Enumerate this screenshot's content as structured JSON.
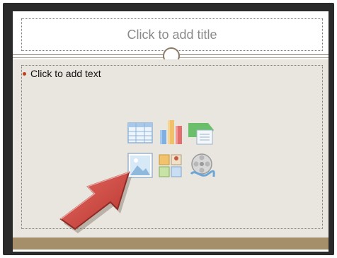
{
  "slide": {
    "title_placeholder": "Click to add title",
    "body_placeholder": "Click to add text"
  },
  "content_icons": [
    {
      "name": "insert-table-icon"
    },
    {
      "name": "insert-chart-icon"
    },
    {
      "name": "insert-smartart-icon"
    },
    {
      "name": "insert-picture-icon"
    },
    {
      "name": "insert-clipart-icon"
    },
    {
      "name": "insert-media-icon"
    }
  ],
  "colors": {
    "frame": "#2a2a2a",
    "content_bg": "#e9e5df",
    "footer_band": "#a58e6a",
    "bullet": "#c0401e",
    "arrow": "#d24b44"
  }
}
